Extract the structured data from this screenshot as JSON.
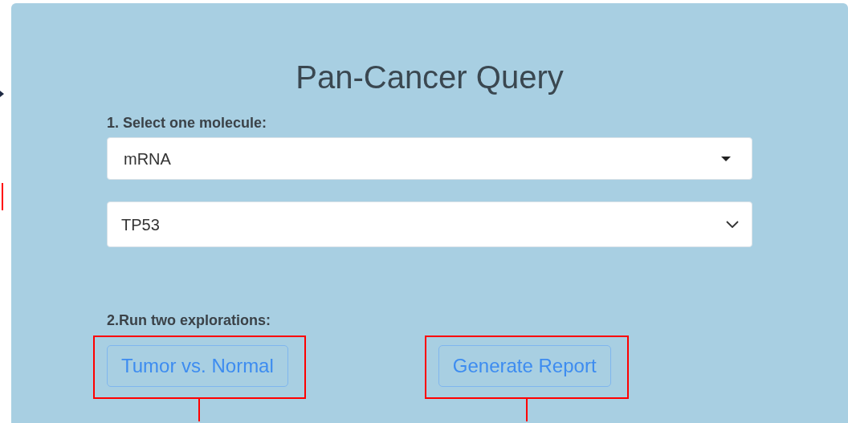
{
  "title": "Pan-Cancer Query",
  "step1": {
    "label": "1. Select one molecule:",
    "selects": [
      {
        "kind": "dropdown",
        "value": "mRNA"
      },
      {
        "kind": "combobox",
        "value": "TP53"
      }
    ]
  },
  "step2": {
    "label": "2.Run two explorations:",
    "buttons": [
      "Tumor vs. Normal",
      "Generate Report"
    ]
  }
}
